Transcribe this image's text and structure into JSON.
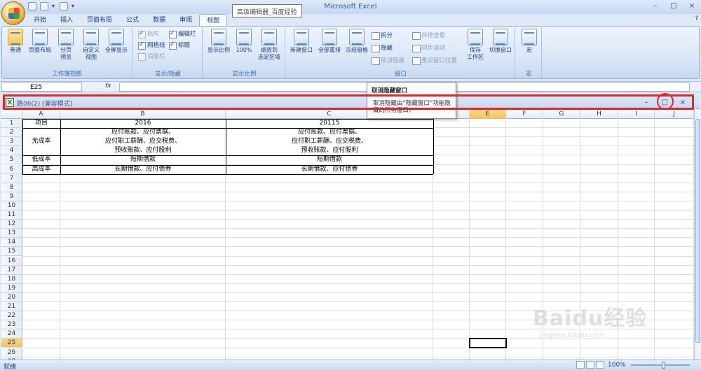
{
  "app": {
    "title": "Microsoft Excel",
    "tooltip": "高级编辑器_百度经验",
    "window_controls": [
      "–",
      "□",
      "×"
    ]
  },
  "tabs": [
    "开始",
    "插入",
    "页面布局",
    "公式",
    "数据",
    "审阅",
    "视图"
  ],
  "active_tab": "视图",
  "ribbon": {
    "groups": {
      "workbook_views": {
        "label": "工作簿视图",
        "buttons": [
          "普通",
          "页面布局",
          "分页\n预览",
          "自定义\n视图",
          "全屏显示"
        ]
      },
      "show_hide": {
        "label": "显示/隐藏",
        "checks": [
          {
            "label": "标尺",
            "checked": true,
            "disabled": true
          },
          {
            "label": "编辑栏",
            "checked": true
          },
          {
            "label": "网格线",
            "checked": true
          },
          {
            "label": "标题",
            "checked": true
          },
          {
            "label": "消息栏",
            "checked": false,
            "disabled": true
          }
        ]
      },
      "zoom": {
        "label": "显示比例",
        "buttons": [
          "显示比例",
          "100%",
          "缩放到\n选定区域"
        ]
      },
      "window": {
        "label": "窗口",
        "big": [
          "新建窗口",
          "全部重排",
          "冻结窗格"
        ],
        "small": [
          "拆分",
          "隐藏",
          "取消隐藏",
          "并排查看",
          "同步滚动",
          "重设窗口位置"
        ],
        "big2": [
          "保存\n工作区",
          "切换窗口"
        ]
      },
      "macro": {
        "label": "宏",
        "buttons": [
          "宏"
        ]
      }
    }
  },
  "formula_bar": {
    "name_box": "E25",
    "fx": "fx",
    "value": ""
  },
  "dropdown": {
    "title": "取消隐藏窗口",
    "desc": "取消隐藏由“隐藏窗口”功能隐藏的所有窗口。"
  },
  "workbook": {
    "title": "路06(2)  [兼容模式]",
    "icon": "excel-icon",
    "controls": [
      "–",
      "□",
      "×"
    ]
  },
  "columns": [
    "A",
    "B",
    "C",
    "",
    "E",
    "F",
    "G",
    "H",
    "I",
    "J"
  ],
  "rows": [
    "1",
    "2",
    "3",
    "4",
    "5",
    "6",
    "7",
    "8",
    "9",
    "10",
    "11",
    "12",
    "13",
    "14",
    "15",
    "16",
    "17",
    "18",
    "19",
    "20",
    "21",
    "22",
    "23",
    "24",
    "25",
    "26",
    "27"
  ],
  "table": {
    "header": [
      "项目",
      "2016",
      "20115"
    ],
    "a_2_4": "无成本",
    "a5": "低成本",
    "a6": "高成本",
    "b": [
      "应付账款、应付票据、",
      "应付职工薪酬、应交税费、",
      "预收账款、应付股利",
      "短期借款",
      "长期借款、应付债券"
    ],
    "c": [
      "应付账款、应付票据、",
      "应付职工薪酬、应交税费、",
      "预收账款、应付股利",
      "短期借款",
      "长期借款、应付债券"
    ]
  },
  "status": {
    "mode": "就绪",
    "zoom": "100%"
  },
  "watermark": {
    "logo": "Baidu经验",
    "url": "jingyan.baidu.com"
  },
  "colors": {
    "accent": "#15428b",
    "highlight": "#e3262a",
    "selected_header": "#f1c15f"
  }
}
